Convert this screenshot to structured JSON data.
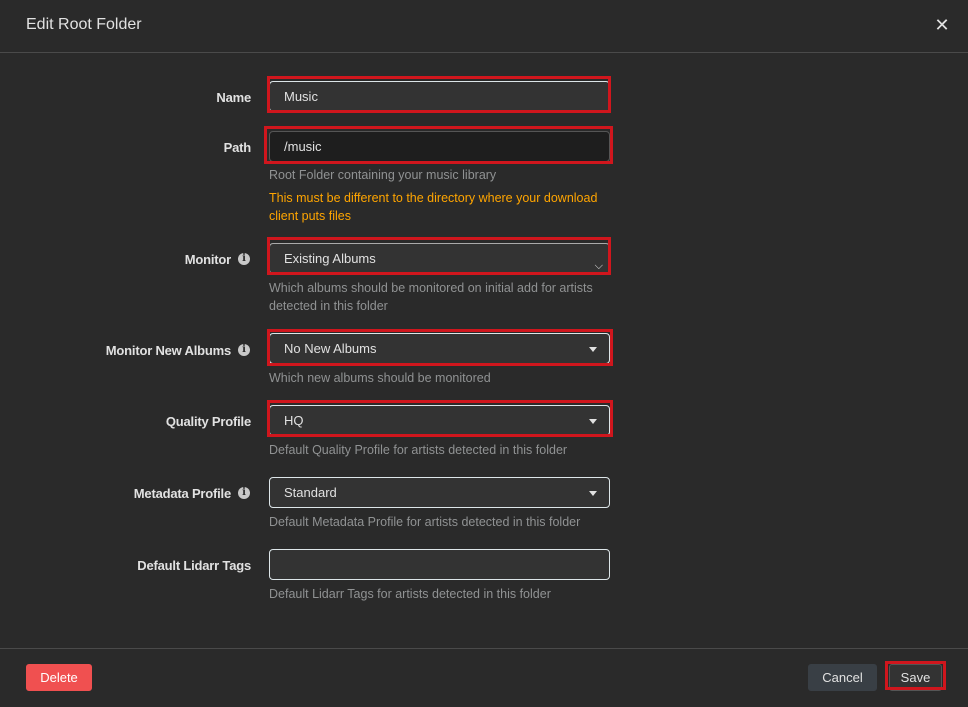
{
  "header": {
    "title": "Edit Root Folder",
    "close_icon": "close-icon"
  },
  "form": {
    "name": {
      "label": "Name",
      "value": "Music"
    },
    "path": {
      "label": "Path",
      "value": "/music",
      "help": "Root Folder containing your music library",
      "warning": "This must be different to the directory where your download client puts files"
    },
    "monitor": {
      "label": "Monitor",
      "value": "Existing Albums",
      "help": "Which albums should be monitored on initial add for artists detected in this folder"
    },
    "monitor_new": {
      "label": "Monitor New Albums",
      "value": "No New Albums",
      "help": "Which new albums should be monitored"
    },
    "quality": {
      "label": "Quality Profile",
      "value": "HQ",
      "help": "Default Quality Profile for artists detected in this folder"
    },
    "metadata": {
      "label": "Metadata Profile",
      "value": "Standard",
      "help": "Default Metadata Profile for artists detected in this folder"
    },
    "tags": {
      "label": "Default Lidarr Tags",
      "value": "",
      "help": "Default Lidarr Tags for artists detected in this folder"
    }
  },
  "footer": {
    "delete_label": "Delete",
    "cancel_label": "Cancel",
    "save_label": "Save"
  },
  "colors": {
    "highlight": "#d0161d",
    "warning": "#ffa500",
    "delete": "#f05050"
  }
}
